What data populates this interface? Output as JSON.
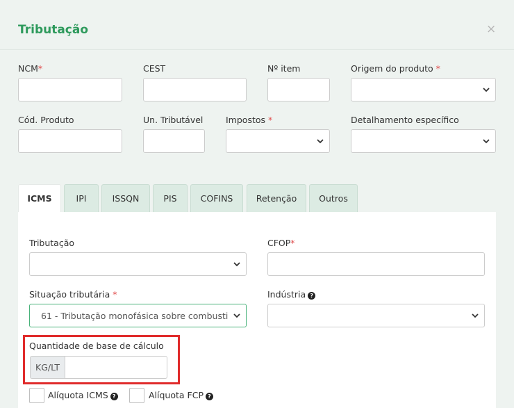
{
  "modal": {
    "title": "Tributação",
    "close": "×"
  },
  "row1": {
    "ncm": {
      "label": "NCM",
      "req": "*",
      "value": ""
    },
    "cest": {
      "label": "CEST",
      "value": ""
    },
    "item": {
      "label": "Nº item",
      "value": ""
    },
    "origem": {
      "label": "Origem do produto",
      "req": "*",
      "selected": ""
    }
  },
  "row2": {
    "cod_produto": {
      "label": "Cód. Produto",
      "value": ""
    },
    "un_tributavel": {
      "label": "Un. Tributável",
      "value": ""
    },
    "impostos": {
      "label": "Impostos",
      "req": "*",
      "selected": ""
    },
    "detalhamento": {
      "label": "Detalhamento específico",
      "selected": ""
    }
  },
  "tabs": [
    "ICMS",
    "IPI",
    "ISSQN",
    "PIS",
    "COFINS",
    "Retenção",
    "Outros"
  ],
  "active_tab": "ICMS",
  "icms": {
    "tributacao": {
      "label": "Tributação",
      "selected": ""
    },
    "cfop": {
      "label": "CFOP",
      "req": "*",
      "value": ""
    },
    "situacao": {
      "label": "Situação tributária",
      "req": "*",
      "selected": "61 - Tributação monofásica sobre combusti"
    },
    "industria": {
      "label": "Indústria",
      "selected": ""
    },
    "quantidade_base": {
      "label": "Quantidade de base de cálculo",
      "addon": "KG/LT",
      "value": ""
    },
    "aliquota_icms": {
      "label": "Alíquota ICMS",
      "checked": false
    },
    "aliquota_fcp": {
      "label": "Alíquota FCP",
      "checked": false
    }
  },
  "colors": {
    "accent": "#2e9a5c",
    "required": "#e04a4a",
    "highlight": "#e02b2b",
    "tab_bg": "#dcebe3"
  }
}
